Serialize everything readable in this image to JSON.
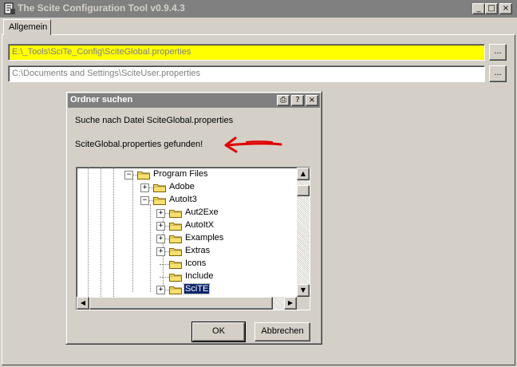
{
  "window": {
    "title": "The Scite Configuration Tool v0.9.4.3",
    "controls": {
      "minimize": "_",
      "maximize": "□",
      "close": "×"
    }
  },
  "tabs": [
    {
      "label": "Allgemein",
      "active": true
    }
  ],
  "fields": {
    "global_path": {
      "value": "E:\\_Tools\\SciTe_Config\\SciteGlobal.properties",
      "highlight_color": "#ffff00"
    },
    "user_path": {
      "value": "C:\\Documents and Settings\\SciteUser.properties"
    },
    "browse_label": "..."
  },
  "dialog": {
    "title": "Ordner suchen",
    "title_buttons": {
      "context": "⎙",
      "help": "?",
      "close": "×"
    },
    "search_text": "Suche nach Datei SciteGlobal.properties",
    "found_text": "SciteGlobal.properties gefunden!",
    "annotation_arrow_color": "#e00000",
    "tree": [
      {
        "label": "Program Files",
        "expander": "−",
        "level": 0,
        "selected": false
      },
      {
        "label": "Adobe",
        "expander": "+",
        "level": 1,
        "selected": false
      },
      {
        "label": "AutoIt3",
        "expander": "−",
        "level": 1,
        "selected": false
      },
      {
        "label": "Aut2Exe",
        "expander": "+",
        "level": 2,
        "selected": false
      },
      {
        "label": "AutoItX",
        "expander": "+",
        "level": 2,
        "selected": false
      },
      {
        "label": "Examples",
        "expander": "+",
        "level": 2,
        "selected": false
      },
      {
        "label": "Extras",
        "expander": "+",
        "level": 2,
        "selected": false
      },
      {
        "label": "Icons",
        "expander": "",
        "level": 2,
        "selected": false
      },
      {
        "label": "Include",
        "expander": "",
        "level": 2,
        "selected": false
      },
      {
        "label": "SciTE",
        "expander": "+",
        "level": 2,
        "selected": true
      }
    ],
    "ok_label": "OK",
    "cancel_label": "Abbrechen"
  },
  "colors": {
    "titlebar_inactive": "#808080",
    "selection": "#0a246a",
    "folder": "#f8e070"
  }
}
